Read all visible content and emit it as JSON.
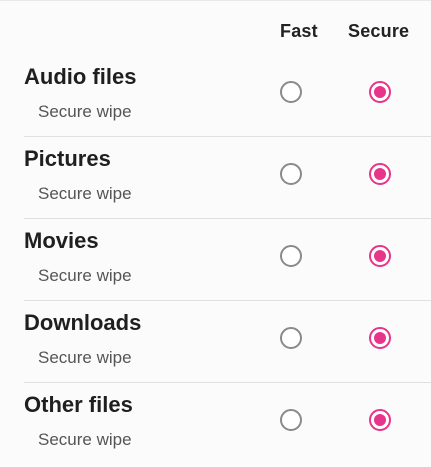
{
  "header": {
    "fast_label": "Fast",
    "secure_label": "Secure"
  },
  "items": [
    {
      "title": "Audio files",
      "subtitle": "Secure wipe",
      "selected": "secure"
    },
    {
      "title": "Pictures",
      "subtitle": "Secure wipe",
      "selected": "secure"
    },
    {
      "title": "Movies",
      "subtitle": "Secure wipe",
      "selected": "secure"
    },
    {
      "title": "Downloads",
      "subtitle": "Secure wipe",
      "selected": "secure"
    },
    {
      "title": "Other files",
      "subtitle": "Secure wipe",
      "selected": "secure"
    }
  ],
  "colors": {
    "accent": "#e6358a",
    "radio_unselected_border": "#8a8a8a"
  }
}
